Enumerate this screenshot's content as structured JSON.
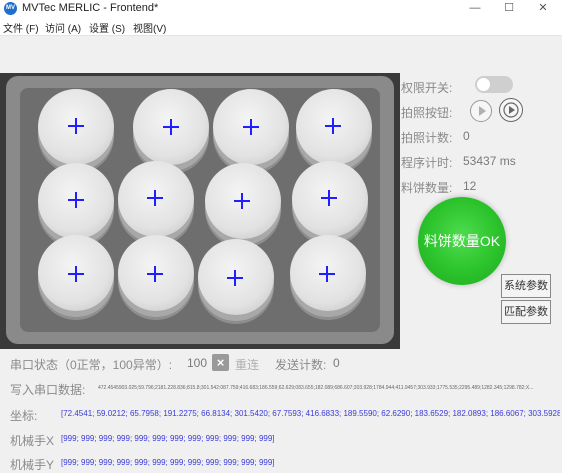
{
  "window": {
    "title": "MVTec MERLIC - Frontend*",
    "logo_text": "MV"
  },
  "menu": [
    {
      "label": "文件 (F)"
    },
    {
      "label": "访问 (A)"
    },
    {
      "label": "设置 (S)"
    },
    {
      "label": "视图(V)"
    }
  ],
  "panel": {
    "permission_label": "权限开关:",
    "capture_button_label": "拍照按钮:",
    "capture_count_label": "拍照计数:",
    "capture_count_value": "0",
    "timer_label": "程序计时:",
    "timer_value": "53437 ms",
    "cookie_count_label": "料饼数量:",
    "cookie_count_value": "12",
    "status_text": "料饼数量OK",
    "system_params_button": "系统参数",
    "match_params_button": "匹配参数"
  },
  "bottom": {
    "serial_status_label": "串口状态（0正常，100异常）:",
    "serial_status_value": "100",
    "reconnect_label": "重连",
    "send_count_label": "发送计数:",
    "send_count_value": "0",
    "write_serial_label": "写入串口数据:",
    "write_serial_value": "472.4545903.025;59.796;2181.228.836;815.8;301.542;087.759;416.683;186.559;62.629;083.655;182.089;686.607;303.928;1784.944;411.9457;303.933;1775.535;2295.489;1282.345;1298.782;X...",
    "coords_label": "坐标:",
    "coords_value": "[72.4541; 59.0212; 65.7958; 191.2275; 66.8134; 301.5420; 67.7593; 416.6833; 189.5590; 62.6290; 183.6529; 182.0893; 186.6067; 303.5928; 184.5442; 411.9457; 303.93...",
    "robot_x_label": "机械手X",
    "robot_x_value": "[999; 999; 999; 999; 999; 999; 999; 999; 999; 999; 999; 999]",
    "robot_y_label": "机械手Y",
    "robot_y_value": "[999; 999; 999; 999; 999; 999; 999; 999; 999; 999; 999; 999]"
  },
  "colors": {
    "status_ok": "#2bc32b",
    "crosshair": "#1f1fff"
  },
  "icons": {
    "minimize": "minimize-icon",
    "maximize": "maximize-icon",
    "close": "close-icon"
  }
}
